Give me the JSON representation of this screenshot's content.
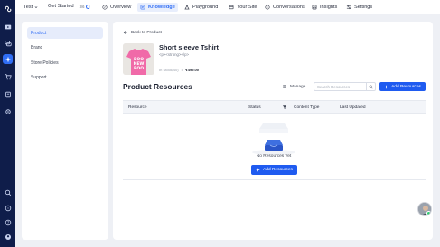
{
  "topnav": {
    "workspace": "Test",
    "get_started": "Get Started",
    "progress": "3/6",
    "tabs": [
      {
        "label": "Overview",
        "icon": "compass-icon"
      },
      {
        "label": "Knowledge",
        "icon": "book-icon",
        "active": true
      },
      {
        "label": "Playground",
        "icon": "flask-icon"
      },
      {
        "label": "Your Site",
        "icon": "site-icon"
      },
      {
        "label": "Conversations",
        "icon": "chat-icon"
      },
      {
        "label": "Insights",
        "icon": "insights-icon"
      },
      {
        "label": "Settings",
        "icon": "sliders-icon"
      }
    ]
  },
  "sidebar": {
    "items": [
      {
        "label": "Product",
        "active": true
      },
      {
        "label": "Brand"
      },
      {
        "label": "Store Policies"
      },
      {
        "label": "Support"
      }
    ]
  },
  "product": {
    "back_label": "Back to Product",
    "title": "Short sleeve Tshirt",
    "description": "<p><strong></p>",
    "stock": "In Stock(40)",
    "separator": "•",
    "price": "₹499.00",
    "thumb_text": "BOO\nNEW\nBOO"
  },
  "resources": {
    "title": "Product Resources",
    "manage_label": "Manage",
    "search_placeholder": "Search Resources",
    "add_label": "Add Resources",
    "columns": [
      "Resource",
      "Status",
      "Content Type",
      "Last Updated"
    ],
    "empty_text": "No Resources Yet",
    "empty_add_label": "Add Resources"
  },
  "colors": {
    "accent": "#1f5bf0",
    "rail": "#0f1d4a",
    "active_bg": "#e8eefc"
  }
}
